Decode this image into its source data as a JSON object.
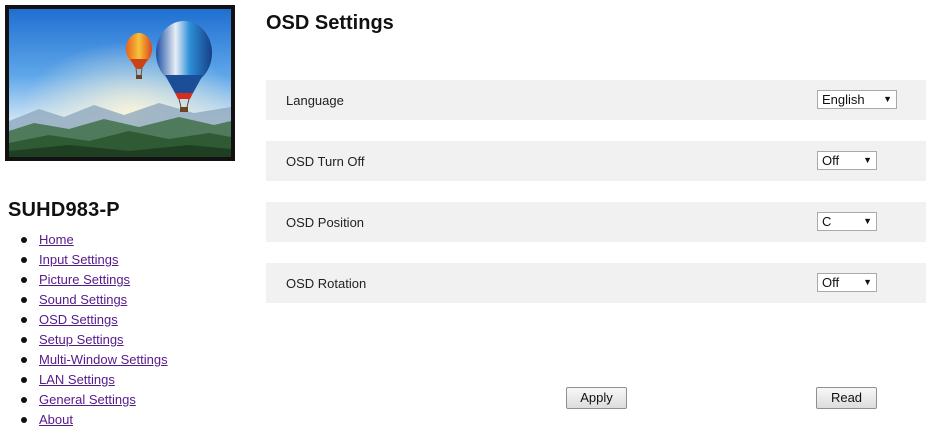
{
  "sidebar": {
    "model_name": "SUHD983-P",
    "nav_items": [
      {
        "label": "Home"
      },
      {
        "label": "Input Settings"
      },
      {
        "label": "Picture Settings"
      },
      {
        "label": "Sound Settings"
      },
      {
        "label": "OSD Settings"
      },
      {
        "label": "Setup Settings"
      },
      {
        "label": "Multi-Window Settings"
      },
      {
        "label": "LAN Settings"
      },
      {
        "label": "General Settings"
      },
      {
        "label": "About"
      }
    ]
  },
  "main": {
    "title": "OSD Settings",
    "settings": [
      {
        "label": "Language",
        "value": "English"
      },
      {
        "label": "OSD Turn Off",
        "value": "Off"
      },
      {
        "label": "OSD Position",
        "value": "C"
      },
      {
        "label": "OSD Rotation",
        "value": "Off"
      }
    ],
    "buttons": {
      "apply": "Apply",
      "read": "Read"
    }
  },
  "colors": {
    "row_background": "#f1f1f1",
    "link": "#551a8b"
  },
  "icons": {
    "dropdown": "triangle-down-icon",
    "bullet": "bullet-icon"
  }
}
